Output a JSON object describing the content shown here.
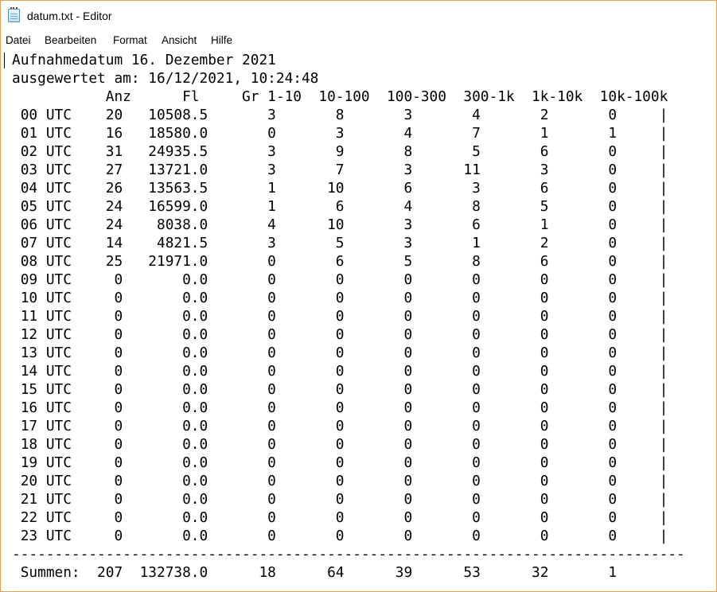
{
  "window": {
    "title": "datum.txt - Editor"
  },
  "menu": [
    "Datei",
    "Bearbeiten",
    "Format",
    "Ansicht",
    "Hilfe"
  ],
  "lines": [
    "Aufnahmedatum 16. Dezember 2021",
    "ausgewertet am: 16/12/2021, 10:24:48",
    "           Anz      Fl     Gr 1-10  10-100  100-300  300-1k  1k-10k  10k-100k",
    " 00 UTC    20   10508.5       3       8       3       4       2       0     |",
    " 01 UTC    16   18580.0       0       3       4       7       1       1     |",
    " 02 UTC    31   24935.5       3       9       8       5       6       0     |",
    " 03 UTC    27   13721.0       3       7       3      11       3       0     |",
    " 04 UTC    26   13563.5       1      10       6       3       6       0     |",
    " 05 UTC    24   16599.0       1       6       4       8       5       0     |",
    " 06 UTC    24    8038.0       4      10       3       6       1       0     |",
    " 07 UTC    14    4821.5       3       5       3       1       2       0     |",
    " 08 UTC    25   21971.0       0       6       5       8       6       0     |",
    " 09 UTC     0       0.0       0       0       0       0       0       0     |",
    " 10 UTC     0       0.0       0       0       0       0       0       0     |",
    " 11 UTC     0       0.0       0       0       0       0       0       0     |",
    " 12 UTC     0       0.0       0       0       0       0       0       0     |",
    " 13 UTC     0       0.0       0       0       0       0       0       0     |",
    " 14 UTC     0       0.0       0       0       0       0       0       0     |",
    " 15 UTC     0       0.0       0       0       0       0       0       0     |",
    " 16 UTC     0       0.0       0       0       0       0       0       0     |",
    " 17 UTC     0       0.0       0       0       0       0       0       0     |",
    " 18 UTC     0       0.0       0       0       0       0       0       0     |",
    " 19 UTC     0       0.0       0       0       0       0       0       0     |",
    " 20 UTC     0       0.0       0       0       0       0       0       0     |",
    " 21 UTC     0       0.0       0       0       0       0       0       0     |",
    " 22 UTC     0       0.0       0       0       0       0       0       0     |",
    " 23 UTC     0       0.0       0       0       0       0       0       0     |",
    "-------------------------------------------------------------------------------",
    " Summen:  207  132738.0      18      64      39      53      32       1"
  ]
}
